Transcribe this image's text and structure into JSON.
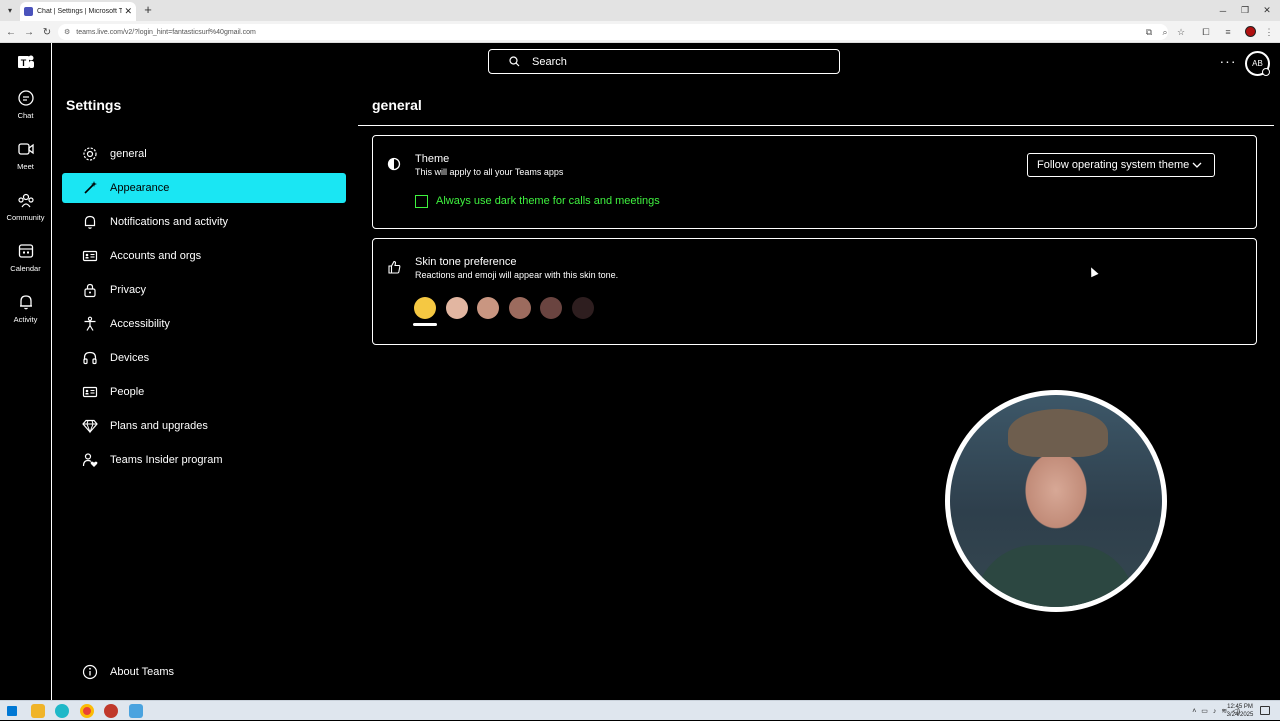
{
  "browser": {
    "tab_title": "Chat | Settings | Microsoft Teams",
    "url": "teams.live.com/v2/?login_hint=fantasticsurf%40gmail.com",
    "new_tab": "+"
  },
  "search": {
    "placeholder": "Search"
  },
  "header": {
    "more": "···",
    "avatar_initials": "AB"
  },
  "rail": {
    "items": [
      {
        "label": "Chat"
      },
      {
        "label": "Meet"
      },
      {
        "label": "Community"
      },
      {
        "label": "Calendar"
      },
      {
        "label": "Activity"
      }
    ]
  },
  "settings": {
    "title": "Settings",
    "nav": [
      {
        "label": "general",
        "icon": "gear-icon"
      },
      {
        "label": "Appearance",
        "icon": "wand-icon"
      },
      {
        "label": "Notifications and activity",
        "icon": "bell-icon"
      },
      {
        "label": "Accounts and orgs",
        "icon": "id-card-icon"
      },
      {
        "label": "Privacy",
        "icon": "lock-icon"
      },
      {
        "label": "Accessibility",
        "icon": "accessibility-icon"
      },
      {
        "label": "Devices",
        "icon": "headset-icon"
      },
      {
        "label": "People",
        "icon": "contact-card-icon"
      },
      {
        "label": "Plans and upgrades",
        "icon": "diamond-icon"
      },
      {
        "label": "Teams Insider program",
        "icon": "person-heart-icon"
      }
    ],
    "about": "About Teams",
    "active_index": 1
  },
  "main": {
    "section_title": "general",
    "theme": {
      "title": "Theme",
      "description": "This will apply to all your Teams apps",
      "selected": "Follow operating system theme",
      "dark_calls_label": "Always use dark theme for calls and meetings",
      "dark_calls_checked": false
    },
    "skin_tone": {
      "title": "Skin tone preference",
      "description": "Reactions and emoji will appear with this skin tone.",
      "tones": [
        "#f5c842",
        "#e2b6a1",
        "#c99681",
        "#9c6b5e",
        "#6a4440",
        "#2e1e1f"
      ],
      "selected_index": 0
    }
  },
  "taskbar": {
    "time": "12:45 PM",
    "date": "3/24/2025"
  },
  "colors": {
    "accent": "#1ae6f3",
    "checkbox_green": "#3ff23f",
    "background": "#000000",
    "foreground": "#ffffff"
  }
}
